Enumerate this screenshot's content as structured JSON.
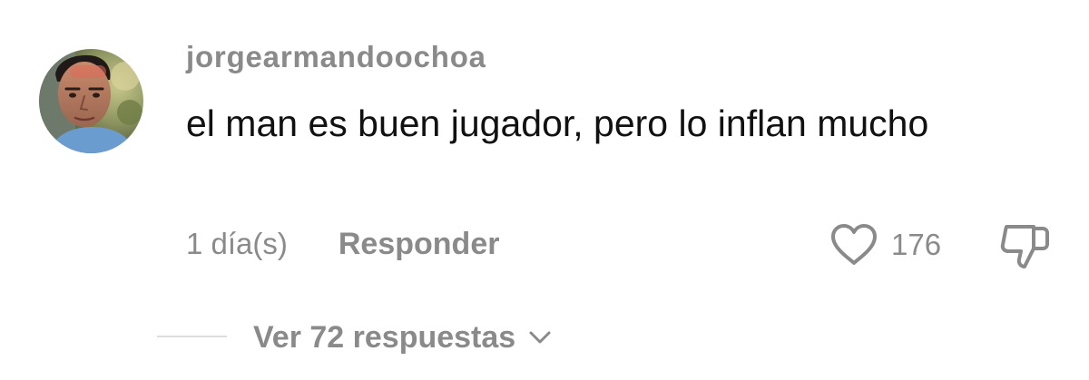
{
  "comment": {
    "username": "jorgearmandoochoa",
    "text": "el man es buen jugador, pero lo inflan mucho",
    "timestamp": "1 día(s)",
    "reply_label": "Responder",
    "like_count": "176",
    "view_replies_label": "Ver 72 respuestas",
    "icons": {
      "avatar": "user-avatar-photo",
      "like": "heart-outline-icon",
      "dislike": "thumbs-down-outline-icon",
      "expand": "chevron-down-icon"
    }
  },
  "colors": {
    "text_primary": "#111111",
    "text_secondary": "#8a8a8a",
    "divider": "#dddddd",
    "background": "#ffffff"
  }
}
